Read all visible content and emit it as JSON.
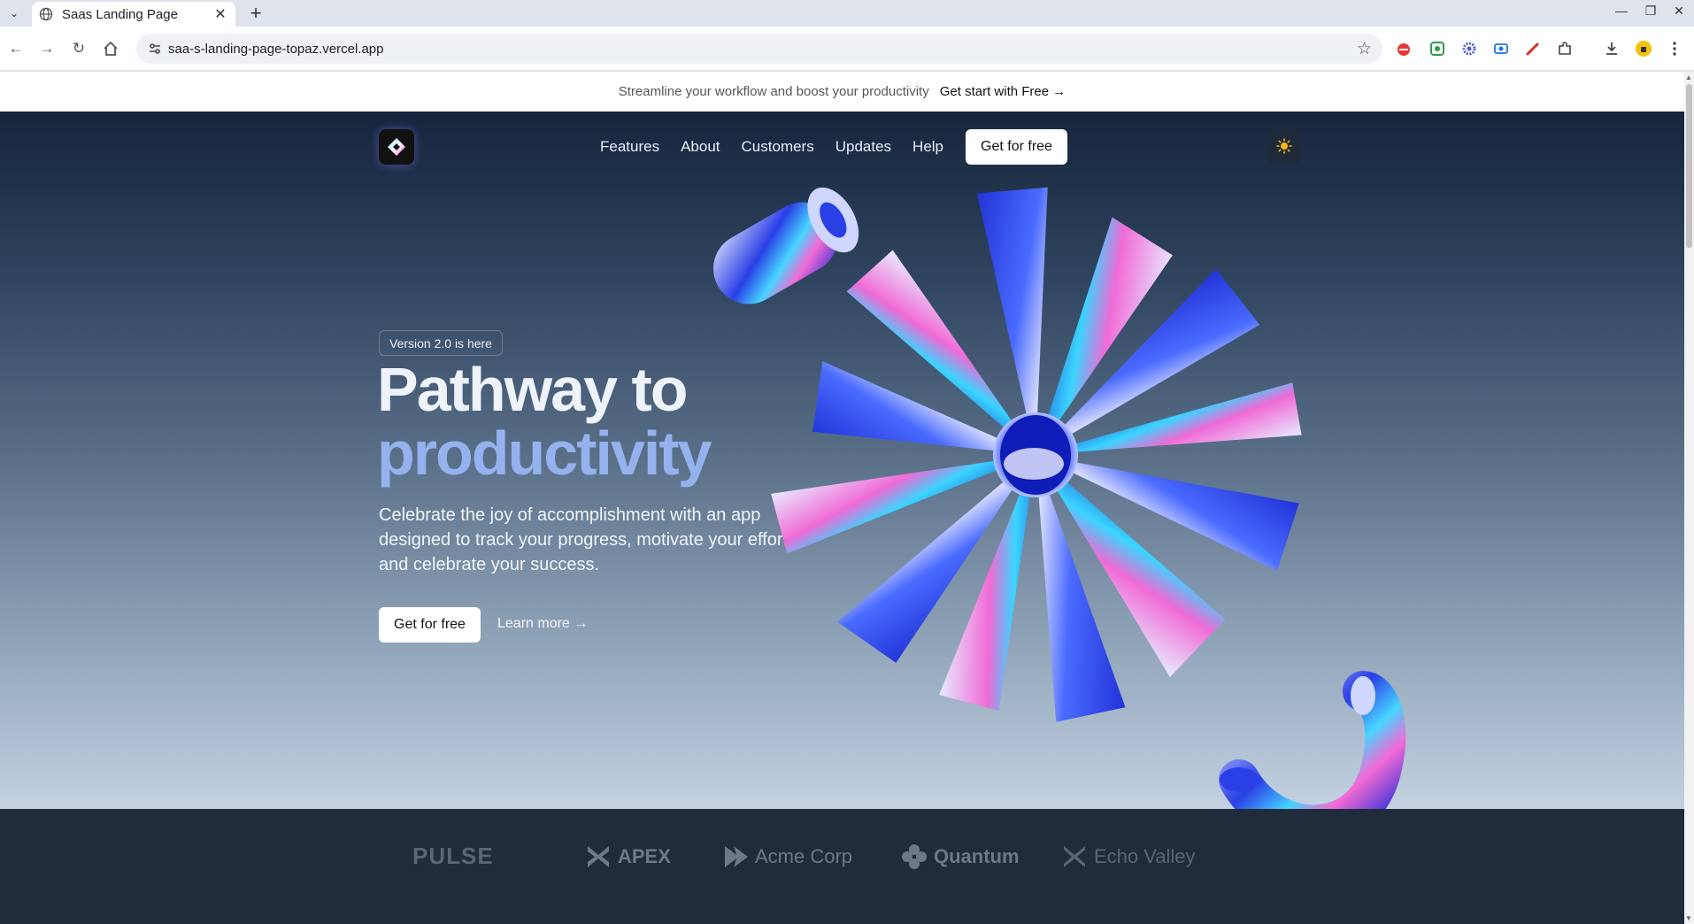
{
  "browser": {
    "tab_title": "Saas Landing Page",
    "url": "saa-s-landing-page-topaz.vercel.app",
    "new_tab_symbol": "+",
    "close_symbol": "✕"
  },
  "announcement": {
    "text": "Streamline your workflow and boost your productivity",
    "cta": "Get start with Free →"
  },
  "nav": {
    "items": [
      "Features",
      "About",
      "Customers",
      "Updates",
      "Help"
    ],
    "cta": "Get for free"
  },
  "hero": {
    "badge": "Version 2.0 is here",
    "title_line1": "Pathway to",
    "title_line2": "productivity",
    "description": "Celebrate the joy of accomplishment with an app designed to track your progress, motivate your efforts, and celebrate your success.",
    "primary_cta": "Get for free",
    "secondary_cta": "Learn more →"
  },
  "logos": [
    "PULSE",
    "APEX",
    "Acme Corp",
    "Quantum",
    "Echo Valley"
  ],
  "colors": {
    "hero_top": "#15253c",
    "hero_bottom": "#c4d2e2",
    "title_accent": "#95b2ef",
    "logo_bar": "#202b3b"
  }
}
